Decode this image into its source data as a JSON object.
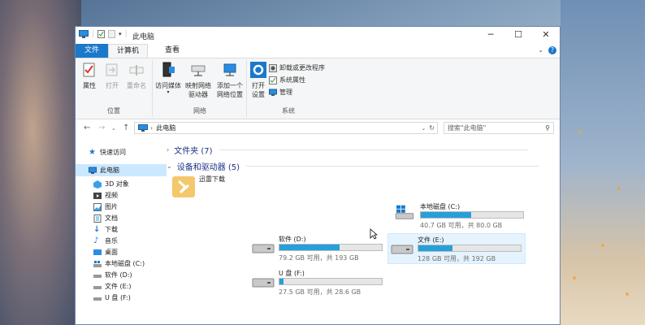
{
  "window": {
    "title": "此电脑"
  },
  "tabs": {
    "file": "文件",
    "computer": "计算机",
    "view": "查看"
  },
  "ribbon": {
    "location": {
      "label": "位置",
      "properties": "属性",
      "open": "打开",
      "rename": "重命名"
    },
    "network": {
      "label": "网络",
      "access_media": "访问媒体",
      "map_drive": "映射网络\n驱动器",
      "add_location": "添加一个\n网络位置"
    },
    "system": {
      "label": "系统",
      "open_settings": "打开\n设置",
      "uninstall": "卸载或更改程序",
      "sys_props": "系统属性",
      "manage": "管理"
    }
  },
  "address": {
    "path": "此电脑",
    "search_placeholder": "搜索\"此电脑\""
  },
  "nav": {
    "quick_access": "快速访问",
    "this_pc": "此电脑",
    "items": [
      "3D 对象",
      "视频",
      "图片",
      "文档",
      "下载",
      "音乐",
      "桌面",
      "本地磁盘 (C:)",
      "软件 (D:)",
      "文件 (E:)",
      "U 盘 (F:)"
    ]
  },
  "content": {
    "folders_header": "文件夹 (7)",
    "devices_header": "设备和驱动器 (5)",
    "drives": [
      {
        "name": "迅雷下载",
        "type": "app"
      },
      {
        "name": "本地磁盘 (C:)",
        "type": "system",
        "free_text": "40.7 GB 可用，共 80.0 GB",
        "used_fraction": 0.49
      },
      {
        "name": "软件 (D:)",
        "type": "disk",
        "free_text": "79.2 GB 可用，共 193 GB",
        "used_fraction": 0.59
      },
      {
        "name": "文件 (E:)",
        "type": "disk",
        "free_text": "128 GB 可用，共 192 GB",
        "used_fraction": 0.33,
        "selected": true
      },
      {
        "name": "U 盘 (F:)",
        "type": "disk",
        "free_text": "27.5 GB 可用，共 28.6 GB",
        "used_fraction": 0.04
      }
    ]
  },
  "colors": {
    "accent": "#1979ca",
    "bar": "#26a0da",
    "header": "#1e3287",
    "selection": "#cce8ff"
  }
}
